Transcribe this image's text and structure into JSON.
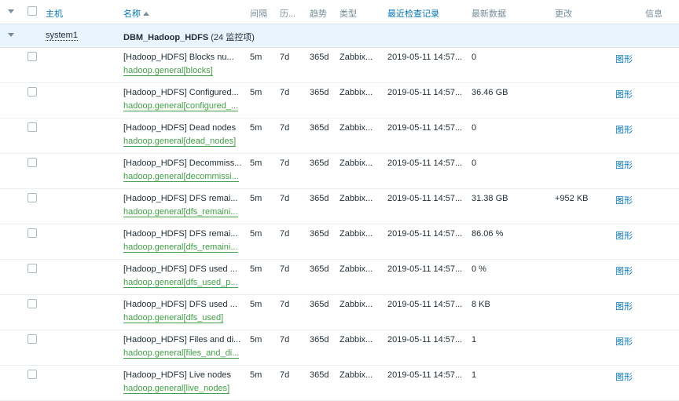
{
  "header": {
    "host": "主机",
    "name": "名称",
    "interval": "间隔",
    "history": "历...",
    "trends": "趋势",
    "type": "类型",
    "last_check": "最近检查记录",
    "last_value": "最新数据",
    "change": "更改",
    "info": "信息"
  },
  "group": {
    "host": "system1",
    "name": "DBM_Hadoop_HDFS",
    "count": "(24 监控项)"
  },
  "rows": [
    {
      "name": "[Hadoop_HDFS] Blocks nu...",
      "key": "hadoop.general[blocks]",
      "interval": "5m",
      "history": "7d",
      "trends": "365d",
      "type": "Zabbix...",
      "last_check": "2019-05-11 14:57...",
      "last_value": "0",
      "change": "",
      "action": "图形"
    },
    {
      "name": "[Hadoop_HDFS] Configured...",
      "key": "hadoop.general[configured_...",
      "interval": "5m",
      "history": "7d",
      "trends": "365d",
      "type": "Zabbix...",
      "last_check": "2019-05-11 14:57...",
      "last_value": "36.46 GB",
      "change": "",
      "action": "图形"
    },
    {
      "name": "[Hadoop_HDFS] Dead nodes",
      "key": "hadoop.general[dead_nodes]",
      "interval": "5m",
      "history": "7d",
      "trends": "365d",
      "type": "Zabbix...",
      "last_check": "2019-05-11 14:57...",
      "last_value": "0",
      "change": "",
      "action": "图形"
    },
    {
      "name": "[Hadoop_HDFS] Decommiss...",
      "key": "hadoop.general[decommissi...",
      "interval": "5m",
      "history": "7d",
      "trends": "365d",
      "type": "Zabbix...",
      "last_check": "2019-05-11 14:57...",
      "last_value": "0",
      "change": "",
      "action": "图形"
    },
    {
      "name": "[Hadoop_HDFS] DFS remai...",
      "key": "hadoop.general[dfs_remaini...",
      "interval": "5m",
      "history": "7d",
      "trends": "365d",
      "type": "Zabbix...",
      "last_check": "2019-05-11 14:57...",
      "last_value": "31.38 GB",
      "change": "+952 KB",
      "action": "图形"
    },
    {
      "name": "[Hadoop_HDFS] DFS remai...",
      "key": "hadoop.general[dfs_remaini...",
      "interval": "5m",
      "history": "7d",
      "trends": "365d",
      "type": "Zabbix...",
      "last_check": "2019-05-11 14:57...",
      "last_value": "86.06 %",
      "change": "",
      "action": "图形"
    },
    {
      "name": "[Hadoop_HDFS] DFS used ...",
      "key": "hadoop.general[dfs_used_p...",
      "interval": "5m",
      "history": "7d",
      "trends": "365d",
      "type": "Zabbix...",
      "last_check": "2019-05-11 14:57...",
      "last_value": "0 %",
      "change": "",
      "action": "图形"
    },
    {
      "name": "[Hadoop_HDFS] DFS used ...",
      "key": "hadoop.general[dfs_used]",
      "interval": "5m",
      "history": "7d",
      "trends": "365d",
      "type": "Zabbix...",
      "last_check": "2019-05-11 14:57...",
      "last_value": "8 KB",
      "change": "",
      "action": "图形"
    },
    {
      "name": "[Hadoop_HDFS] Files and di...",
      "key": "hadoop.general[files_and_di...",
      "interval": "5m",
      "history": "7d",
      "trends": "365d",
      "type": "Zabbix...",
      "last_check": "2019-05-11 14:57...",
      "last_value": "1",
      "change": "",
      "action": "图形"
    },
    {
      "name": "[Hadoop_HDFS] Live nodes",
      "key": "hadoop.general[live_nodes]",
      "interval": "5m",
      "history": "7d",
      "trends": "365d",
      "type": "Zabbix...",
      "last_check": "2019-05-11 14:57...",
      "last_value": "1",
      "change": "",
      "action": "图形"
    }
  ]
}
